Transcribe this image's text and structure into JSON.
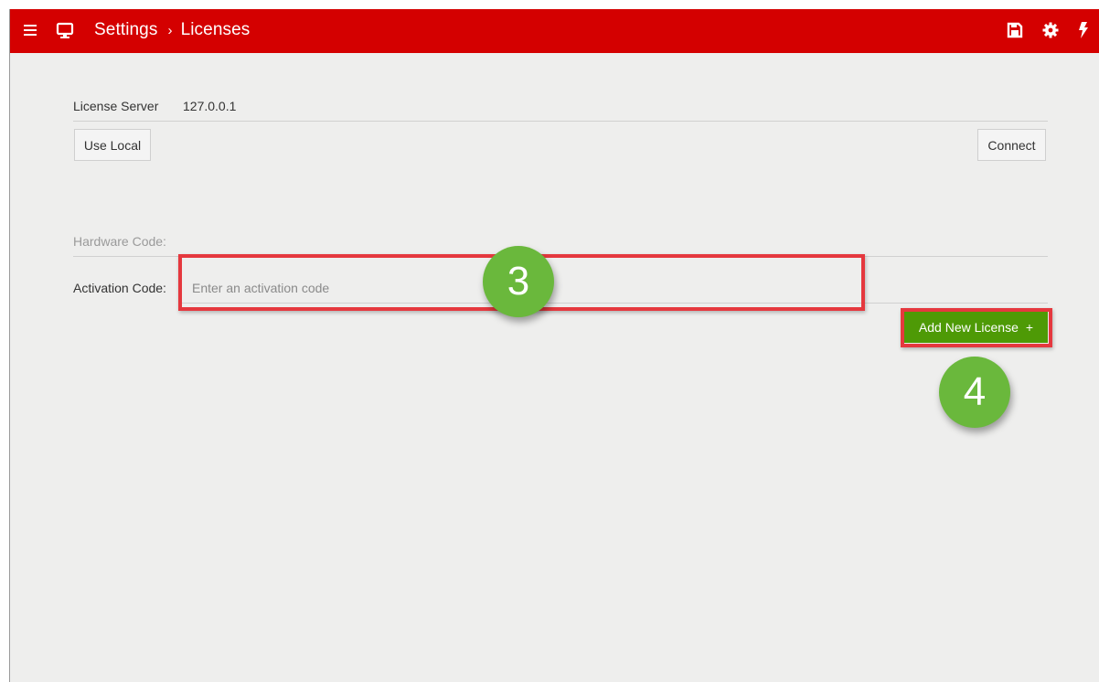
{
  "header": {
    "crumb_root": "Settings",
    "crumb_sep": "›",
    "crumb_current": "Licenses"
  },
  "icons": {
    "menu": "hamburger-icon",
    "monitor": "monitor-icon",
    "save": "save-icon",
    "settings": "gear-icon",
    "power": "bolt-icon"
  },
  "license_server": {
    "label": "License Server",
    "value": "127.0.0.1",
    "use_local_label": "Use Local",
    "connect_label": "Connect"
  },
  "hardware_code": {
    "label": "Hardware Code:"
  },
  "activation_code": {
    "label": "Activation Code:",
    "placeholder": "Enter an activation code",
    "value": ""
  },
  "add_license": {
    "label": "Add New License",
    "icon": "+"
  },
  "annotations": {
    "step3": "3",
    "step4": "4"
  },
  "colors": {
    "header": "#d40000",
    "primary_button": "#4e9a06",
    "highlight": "#e5383e",
    "badge": "#6ab83c",
    "background": "#eeeeed"
  }
}
